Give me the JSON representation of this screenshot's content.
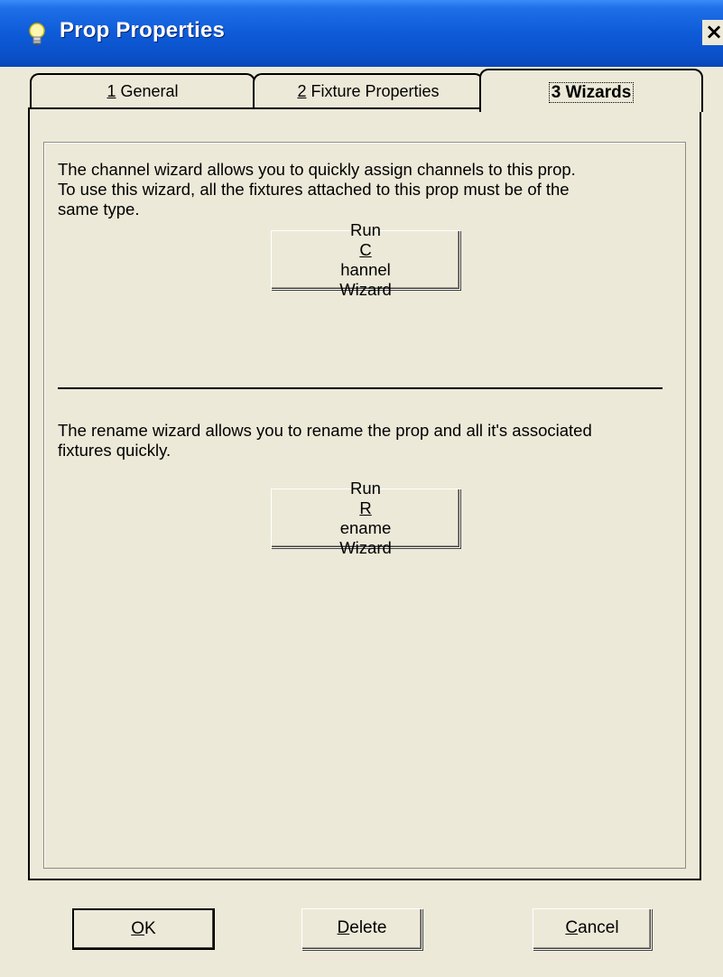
{
  "window": {
    "title": "Prop Properties",
    "icon": "lightbulb-icon",
    "close_label": "×"
  },
  "tabs": [
    {
      "key": "1",
      "label": " General",
      "active": false
    },
    {
      "key": "2",
      "label": " Fixture Properties",
      "active": false
    },
    {
      "key": "3",
      "label": " Wizards",
      "active": true
    }
  ],
  "wizards": {
    "channel_text": [
      "The channel wizard allows you to quickly assign channels to this prop.",
      "To use this wizard, all the fixtures attached to this prop must be of the",
      "same type."
    ],
    "channel_button": {
      "line1_pre": "Run ",
      "line1_key": "C",
      "line1_post": "hannel",
      "line2": "Wizard"
    },
    "rename_text": [
      "The rename wizard allows you to rename the prop and all it's associated",
      "fixtures quickly."
    ],
    "rename_button": {
      "line1_pre": "Run ",
      "line1_key": "R",
      "line1_post": "ename",
      "line2": "Wizard"
    }
  },
  "footer": {
    "ok": {
      "key": "O",
      "rest": "K"
    },
    "delete": {
      "key": "D",
      "rest": "elete"
    },
    "cancel": {
      "key": "C",
      "rest": "ancel"
    }
  },
  "colors": {
    "titlebar": "#0A50C8",
    "dialog_bg": "#ECE9D8"
  }
}
